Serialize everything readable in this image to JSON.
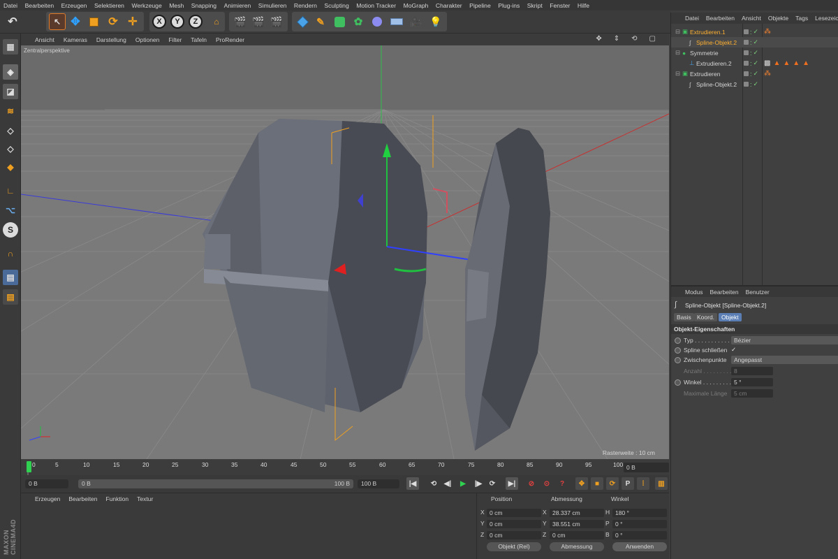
{
  "menu": {
    "items": [
      "Datei",
      "Bearbeiten",
      "Erzeugen",
      "Selektieren",
      "Werkzeuge",
      "Mesh",
      "Snapping",
      "Animieren",
      "Simulieren",
      "Rendern",
      "Sculpting",
      "Motion Tracker",
      "MoGraph",
      "Charakter",
      "Pipeline",
      "Plug-ins",
      "Skript",
      "Fenster",
      "Hilfe"
    ]
  },
  "toolbar": {
    "axis_x": "X",
    "axis_y": "Y",
    "axis_z": "Z"
  },
  "viewport": {
    "menu": [
      "Ansicht",
      "Kameras",
      "Darstellung",
      "Optionen",
      "Filter",
      "Tafeln",
      "ProRender"
    ],
    "label": "Zentralperspektive",
    "raster": "Rasterweite : 10 cm"
  },
  "timeline": {
    "ticks": [
      "0",
      "5",
      "10",
      "15",
      "20",
      "25",
      "30",
      "35",
      "40",
      "45",
      "50",
      "55",
      "60",
      "65",
      "70",
      "75",
      "80",
      "85",
      "90",
      "95",
      "100"
    ],
    "current_frame": "0 B",
    "start_field": "0 B",
    "range_start": "0 B",
    "range_end": "100 B",
    "end_field": "100 B"
  },
  "material_manager": {
    "menu": [
      "Erzeugen",
      "Bearbeiten",
      "Funktion",
      "Textur"
    ]
  },
  "coordinates": {
    "headers": [
      "Position",
      "Abmessung",
      "Winkel"
    ],
    "rows": [
      {
        "axis": "X",
        "pos": "0 cm",
        "size_axis": "X",
        "size": "28.337 cm",
        "rot_axis": "H",
        "rot": "180 °"
      },
      {
        "axis": "Y",
        "pos": "0 cm",
        "size_axis": "Y",
        "size": "38.551 cm",
        "rot_axis": "P",
        "rot": "0 °"
      },
      {
        "axis": "Z",
        "pos": "0 cm",
        "size_axis": "Z",
        "size": "0 cm",
        "rot_axis": "B",
        "rot": "0 °"
      }
    ],
    "mode": "Objekt (Rel)",
    "size_mode": "Abmessung",
    "apply": "Anwenden"
  },
  "object_manager": {
    "menu": [
      "Datei",
      "Bearbeiten",
      "Ansicht",
      "Objekte",
      "Tags",
      "Lesezeichen"
    ],
    "objects": [
      {
        "name": "Extrudieren.1",
        "level": 0,
        "selected": true
      },
      {
        "name": "Spline-Objekt.2",
        "level": 1,
        "selected": true
      },
      {
        "name": "Symmetrie",
        "level": 0,
        "selected": false
      },
      {
        "name": "Extrudieren.2",
        "level": 1,
        "selected": false
      },
      {
        "name": "Extrudieren",
        "level": 0,
        "selected": false
      },
      {
        "name": "Spline-Objekt.2",
        "level": 1,
        "selected": false
      }
    ]
  },
  "attribute_manager": {
    "menu": [
      "Modus",
      "Bearbeiten",
      "Benutzer"
    ],
    "title": "Spline-Objekt [Spline-Objekt.2]",
    "tabs": [
      "Basis",
      "Koord.",
      "Objekt"
    ],
    "active_tab": "Objekt",
    "section": "Objekt-Eigenschaften",
    "fields": [
      {
        "label": "Typ . . . . . . . . . . . .",
        "value": "Bézier",
        "enabled": true
      },
      {
        "label": "Spline schließen",
        "value": "✓",
        "enabled": true
      },
      {
        "label": "Zwischenpunkte",
        "value": "Angepasst",
        "enabled": true
      },
      {
        "label": "Anzahl . . . . . . . . .",
        "value": "8",
        "enabled": false
      },
      {
        "label": "Winkel . . . . . . . . .",
        "value": "5 °",
        "enabled": true
      },
      {
        "label": "Maximale Länge",
        "value": "5 cm",
        "enabled": false
      }
    ]
  },
  "brand": "MAXON CINEMA4D",
  "colors": {
    "accent_orange": "#f0a020",
    "selected_text": "#ffb030",
    "axis_x": "#e02020",
    "axis_y": "#20c040",
    "axis_z": "#3040ff"
  }
}
